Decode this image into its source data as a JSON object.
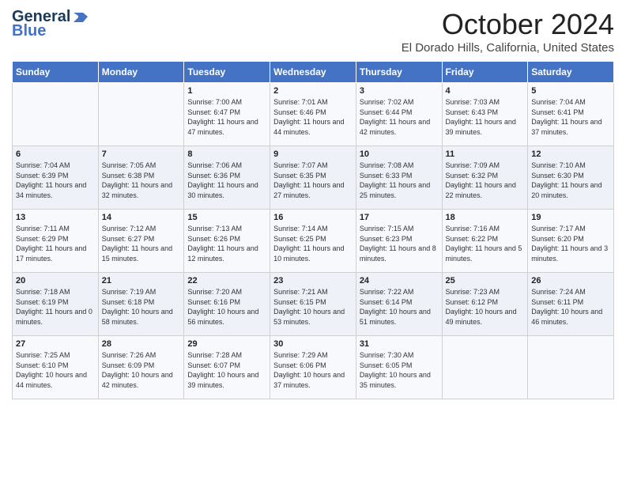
{
  "header": {
    "logo_line1": "General",
    "logo_line2": "Blue",
    "month": "October 2024",
    "location": "El Dorado Hills, California, United States"
  },
  "weekdays": [
    "Sunday",
    "Monday",
    "Tuesday",
    "Wednesday",
    "Thursday",
    "Friday",
    "Saturday"
  ],
  "weeks": [
    [
      {
        "day": "",
        "sunrise": "",
        "sunset": "",
        "daylight": ""
      },
      {
        "day": "",
        "sunrise": "",
        "sunset": "",
        "daylight": ""
      },
      {
        "day": "1",
        "sunrise": "Sunrise: 7:00 AM",
        "sunset": "Sunset: 6:47 PM",
        "daylight": "Daylight: 11 hours and 47 minutes."
      },
      {
        "day": "2",
        "sunrise": "Sunrise: 7:01 AM",
        "sunset": "Sunset: 6:46 PM",
        "daylight": "Daylight: 11 hours and 44 minutes."
      },
      {
        "day": "3",
        "sunrise": "Sunrise: 7:02 AM",
        "sunset": "Sunset: 6:44 PM",
        "daylight": "Daylight: 11 hours and 42 minutes."
      },
      {
        "day": "4",
        "sunrise": "Sunrise: 7:03 AM",
        "sunset": "Sunset: 6:43 PM",
        "daylight": "Daylight: 11 hours and 39 minutes."
      },
      {
        "day": "5",
        "sunrise": "Sunrise: 7:04 AM",
        "sunset": "Sunset: 6:41 PM",
        "daylight": "Daylight: 11 hours and 37 minutes."
      }
    ],
    [
      {
        "day": "6",
        "sunrise": "Sunrise: 7:04 AM",
        "sunset": "Sunset: 6:39 PM",
        "daylight": "Daylight: 11 hours and 34 minutes."
      },
      {
        "day": "7",
        "sunrise": "Sunrise: 7:05 AM",
        "sunset": "Sunset: 6:38 PM",
        "daylight": "Daylight: 11 hours and 32 minutes."
      },
      {
        "day": "8",
        "sunrise": "Sunrise: 7:06 AM",
        "sunset": "Sunset: 6:36 PM",
        "daylight": "Daylight: 11 hours and 30 minutes."
      },
      {
        "day": "9",
        "sunrise": "Sunrise: 7:07 AM",
        "sunset": "Sunset: 6:35 PM",
        "daylight": "Daylight: 11 hours and 27 minutes."
      },
      {
        "day": "10",
        "sunrise": "Sunrise: 7:08 AM",
        "sunset": "Sunset: 6:33 PM",
        "daylight": "Daylight: 11 hours and 25 minutes."
      },
      {
        "day": "11",
        "sunrise": "Sunrise: 7:09 AM",
        "sunset": "Sunset: 6:32 PM",
        "daylight": "Daylight: 11 hours and 22 minutes."
      },
      {
        "day": "12",
        "sunrise": "Sunrise: 7:10 AM",
        "sunset": "Sunset: 6:30 PM",
        "daylight": "Daylight: 11 hours and 20 minutes."
      }
    ],
    [
      {
        "day": "13",
        "sunrise": "Sunrise: 7:11 AM",
        "sunset": "Sunset: 6:29 PM",
        "daylight": "Daylight: 11 hours and 17 minutes."
      },
      {
        "day": "14",
        "sunrise": "Sunrise: 7:12 AM",
        "sunset": "Sunset: 6:27 PM",
        "daylight": "Daylight: 11 hours and 15 minutes."
      },
      {
        "day": "15",
        "sunrise": "Sunrise: 7:13 AM",
        "sunset": "Sunset: 6:26 PM",
        "daylight": "Daylight: 11 hours and 12 minutes."
      },
      {
        "day": "16",
        "sunrise": "Sunrise: 7:14 AM",
        "sunset": "Sunset: 6:25 PM",
        "daylight": "Daylight: 11 hours and 10 minutes."
      },
      {
        "day": "17",
        "sunrise": "Sunrise: 7:15 AM",
        "sunset": "Sunset: 6:23 PM",
        "daylight": "Daylight: 11 hours and 8 minutes."
      },
      {
        "day": "18",
        "sunrise": "Sunrise: 7:16 AM",
        "sunset": "Sunset: 6:22 PM",
        "daylight": "Daylight: 11 hours and 5 minutes."
      },
      {
        "day": "19",
        "sunrise": "Sunrise: 7:17 AM",
        "sunset": "Sunset: 6:20 PM",
        "daylight": "Daylight: 11 hours and 3 minutes."
      }
    ],
    [
      {
        "day": "20",
        "sunrise": "Sunrise: 7:18 AM",
        "sunset": "Sunset: 6:19 PM",
        "daylight": "Daylight: 11 hours and 0 minutes."
      },
      {
        "day": "21",
        "sunrise": "Sunrise: 7:19 AM",
        "sunset": "Sunset: 6:18 PM",
        "daylight": "Daylight: 10 hours and 58 minutes."
      },
      {
        "day": "22",
        "sunrise": "Sunrise: 7:20 AM",
        "sunset": "Sunset: 6:16 PM",
        "daylight": "Daylight: 10 hours and 56 minutes."
      },
      {
        "day": "23",
        "sunrise": "Sunrise: 7:21 AM",
        "sunset": "Sunset: 6:15 PM",
        "daylight": "Daylight: 10 hours and 53 minutes."
      },
      {
        "day": "24",
        "sunrise": "Sunrise: 7:22 AM",
        "sunset": "Sunset: 6:14 PM",
        "daylight": "Daylight: 10 hours and 51 minutes."
      },
      {
        "day": "25",
        "sunrise": "Sunrise: 7:23 AM",
        "sunset": "Sunset: 6:12 PM",
        "daylight": "Daylight: 10 hours and 49 minutes."
      },
      {
        "day": "26",
        "sunrise": "Sunrise: 7:24 AM",
        "sunset": "Sunset: 6:11 PM",
        "daylight": "Daylight: 10 hours and 46 minutes."
      }
    ],
    [
      {
        "day": "27",
        "sunrise": "Sunrise: 7:25 AM",
        "sunset": "Sunset: 6:10 PM",
        "daylight": "Daylight: 10 hours and 44 minutes."
      },
      {
        "day": "28",
        "sunrise": "Sunrise: 7:26 AM",
        "sunset": "Sunset: 6:09 PM",
        "daylight": "Daylight: 10 hours and 42 minutes."
      },
      {
        "day": "29",
        "sunrise": "Sunrise: 7:28 AM",
        "sunset": "Sunset: 6:07 PM",
        "daylight": "Daylight: 10 hours and 39 minutes."
      },
      {
        "day": "30",
        "sunrise": "Sunrise: 7:29 AM",
        "sunset": "Sunset: 6:06 PM",
        "daylight": "Daylight: 10 hours and 37 minutes."
      },
      {
        "day": "31",
        "sunrise": "Sunrise: 7:30 AM",
        "sunset": "Sunset: 6:05 PM",
        "daylight": "Daylight: 10 hours and 35 minutes."
      },
      {
        "day": "",
        "sunrise": "",
        "sunset": "",
        "daylight": ""
      },
      {
        "day": "",
        "sunrise": "",
        "sunset": "",
        "daylight": ""
      }
    ]
  ]
}
